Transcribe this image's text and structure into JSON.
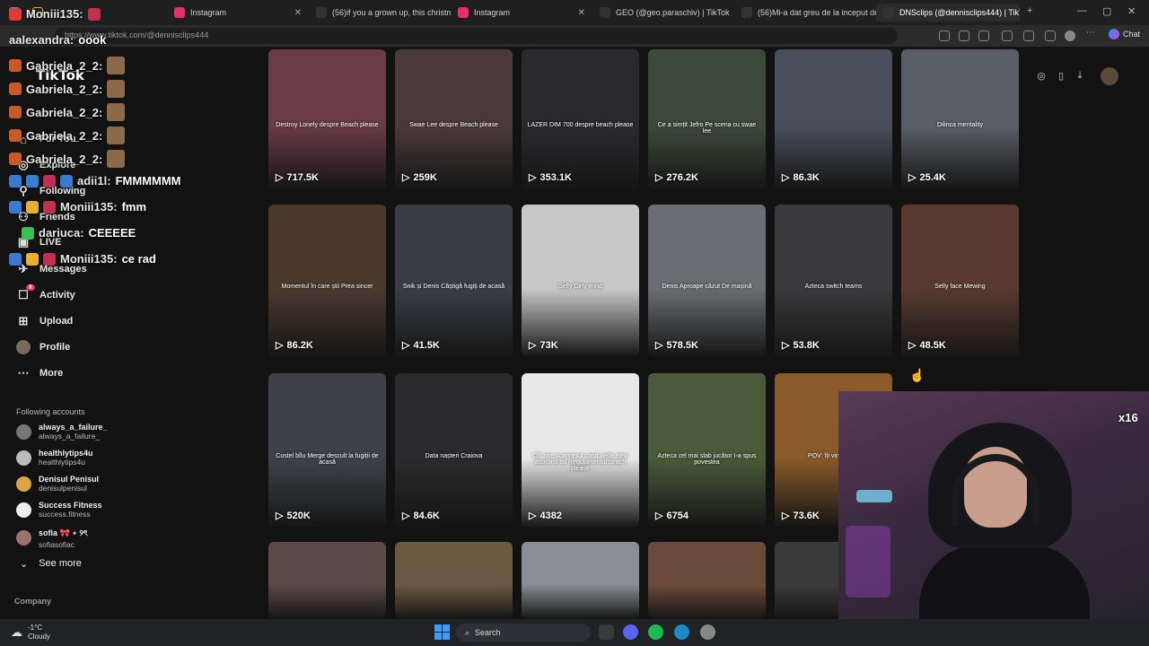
{
  "browser": {
    "tabs": [
      {
        "title": "Instagram",
        "color": "#e1306c",
        "active": false
      },
      {
        "title": "(56)if you a grown up, this christm",
        "color": "#111111",
        "active": false
      },
      {
        "title": "Instagram",
        "color": "#e1306c",
        "active": false
      },
      {
        "title": "GEO (@geo.paraschiv) | TikTok",
        "color": "#111111",
        "active": false
      },
      {
        "title": "(56)Mi-a dat greu de la inceput de",
        "color": "#111111",
        "active": false
      },
      {
        "title": "DNSclips (@dennisclips444) | TikT",
        "color": "#111111",
        "active": true
      }
    ],
    "url": "https://www.tiktok.com/@dennisclips444",
    "chat_label": "Chat"
  },
  "sidebar": {
    "logo": "TikTok",
    "nav": [
      {
        "label": "For You",
        "icon": "home-icon"
      },
      {
        "label": "Explore",
        "icon": "compass-icon"
      },
      {
        "label": "Following",
        "icon": "following-icon"
      },
      {
        "label": "Friends",
        "icon": "friends-icon"
      },
      {
        "label": "LIVE",
        "icon": "live-icon"
      },
      {
        "label": "Messages",
        "icon": "messages-icon"
      },
      {
        "label": "Activity",
        "icon": "activity-icon",
        "badge": "6"
      },
      {
        "label": "Upload",
        "icon": "upload-icon"
      },
      {
        "label": "Profile",
        "icon": "profile-icon"
      },
      {
        "label": "More",
        "icon": "more-icon"
      }
    ],
    "following_title": "Following accounts",
    "accounts": [
      {
        "name": "always_a_failure_",
        "handle": "always_a_failure_",
        "color": "#777777"
      },
      {
        "name": "healthlytips4u",
        "handle": "healthlytips4u",
        "color": "#bbbbbb"
      },
      {
        "name": "Denisul Penisul",
        "handle": "denisulpenisul",
        "color": "#d9a441"
      },
      {
        "name": "Success Fitness",
        "handle": "success.fitness",
        "color": "#eeeeee"
      },
      {
        "name": "sofia 🎀 ⋆ ୨ৎ",
        "handle": "sofiasofiac",
        "color": "#a07070"
      }
    ],
    "see_more": "See more",
    "company": "Company"
  },
  "chat_overlay": [
    {
      "user": "Moniii135:",
      "message": ""
    },
    {
      "user": "aalexandra:",
      "message": "oook"
    },
    {
      "user": "Gabriela_2_2:",
      "message": ""
    },
    {
      "user": "Gabriela_2_2:",
      "message": ""
    },
    {
      "user": "Gabriela_2_2:",
      "message": ""
    },
    {
      "user": "Gabriela_2_2:",
      "message": ""
    },
    {
      "user": "Gabriela_2_2:",
      "message": ""
    },
    {
      "user": "adii1l:",
      "message": "FMMMMMM"
    },
    {
      "user": "Moniii135:",
      "message": "fmm"
    },
    {
      "user": "dariuca:",
      "message": "CEEEEE"
    },
    {
      "user": "Moniii135:",
      "message": "ce rad"
    }
  ],
  "videos": [
    {
      "views": "717.5K",
      "caption": "Destroy Lonely despre Beach please",
      "bg": "#6b3b4a"
    },
    {
      "views": "259K",
      "caption": "Swae Lee despre Beach please",
      "bg": "#4a3a3a"
    },
    {
      "views": "353.1K",
      "caption": "LAZER DIM 700 despre beach please",
      "bg": "#2a2a2e"
    },
    {
      "views": "276.2K",
      "caption": "Ce a simțit Jefro Pe scena cu swae lee",
      "bg": "#3d4a3a"
    },
    {
      "views": "86.3K",
      "caption": "",
      "bg": "#4a4e5a"
    },
    {
      "views": "25.4K",
      "caption": "Dilinca mentality",
      "bg": "#5a5e66"
    },
    {
      "views": "86.2K",
      "caption": "Momentul în care știi Prea sincer",
      "bg": "#4a3a2e"
    },
    {
      "views": "41.5K",
      "caption": "Snik și Denis Câștigă fugiți de acasă",
      "bg": "#3a3e44"
    },
    {
      "views": "73K",
      "caption": "Selly Dirty mind",
      "bg": "#c8c8c8"
    },
    {
      "views": "578.5K",
      "caption": "Denis Aproape căzut De mașină",
      "bg": "#6a6e72"
    },
    {
      "views": "53.8K",
      "caption": "Azteca switch teams",
      "bg": "#3a3a3c"
    },
    {
      "views": "48.5K",
      "caption": "Selly face Mewing",
      "bg": "#5a3a30"
    },
    {
      "views": "520K",
      "caption": "Costel bîlu Merge descult la fugiții de acasă",
      "bg": "#3e4248"
    },
    {
      "views": "84.6K",
      "caption": "Data nașteri Craiova",
      "bg": "#2a2a2c"
    },
    {
      "views": "4382",
      "caption": "CE zice scannerul cand vede elevi asociind cu Regulamentul beach please",
      "bg": "#e8e8e8"
    },
    {
      "views": "6754",
      "caption": "Azteca cel mai slab jucător I-a spus povestea",
      "bg": "#4a5a3a"
    },
    {
      "views": "73.6K",
      "caption": "POV: îți vine Buna",
      "bg": "#8a5a2a"
    },
    {
      "views": "",
      "caption": "",
      "bg": "#7a5a3a"
    },
    {
      "views": "",
      "caption": "",
      "bg": "#5a4a48"
    },
    {
      "views": "",
      "caption": "",
      "bg": "#6a5a44"
    },
    {
      "views": "",
      "caption": "",
      "bg": "#8a8e92"
    },
    {
      "views": "",
      "caption": "",
      "bg": "#6a4a3a"
    },
    {
      "views": "",
      "caption": "",
      "bg": "#3a3a3a"
    }
  ],
  "webcam": {
    "badge": "x16"
  },
  "taskbar": {
    "temp": "-1°C",
    "condition": "Cloudy",
    "search": "Search"
  }
}
